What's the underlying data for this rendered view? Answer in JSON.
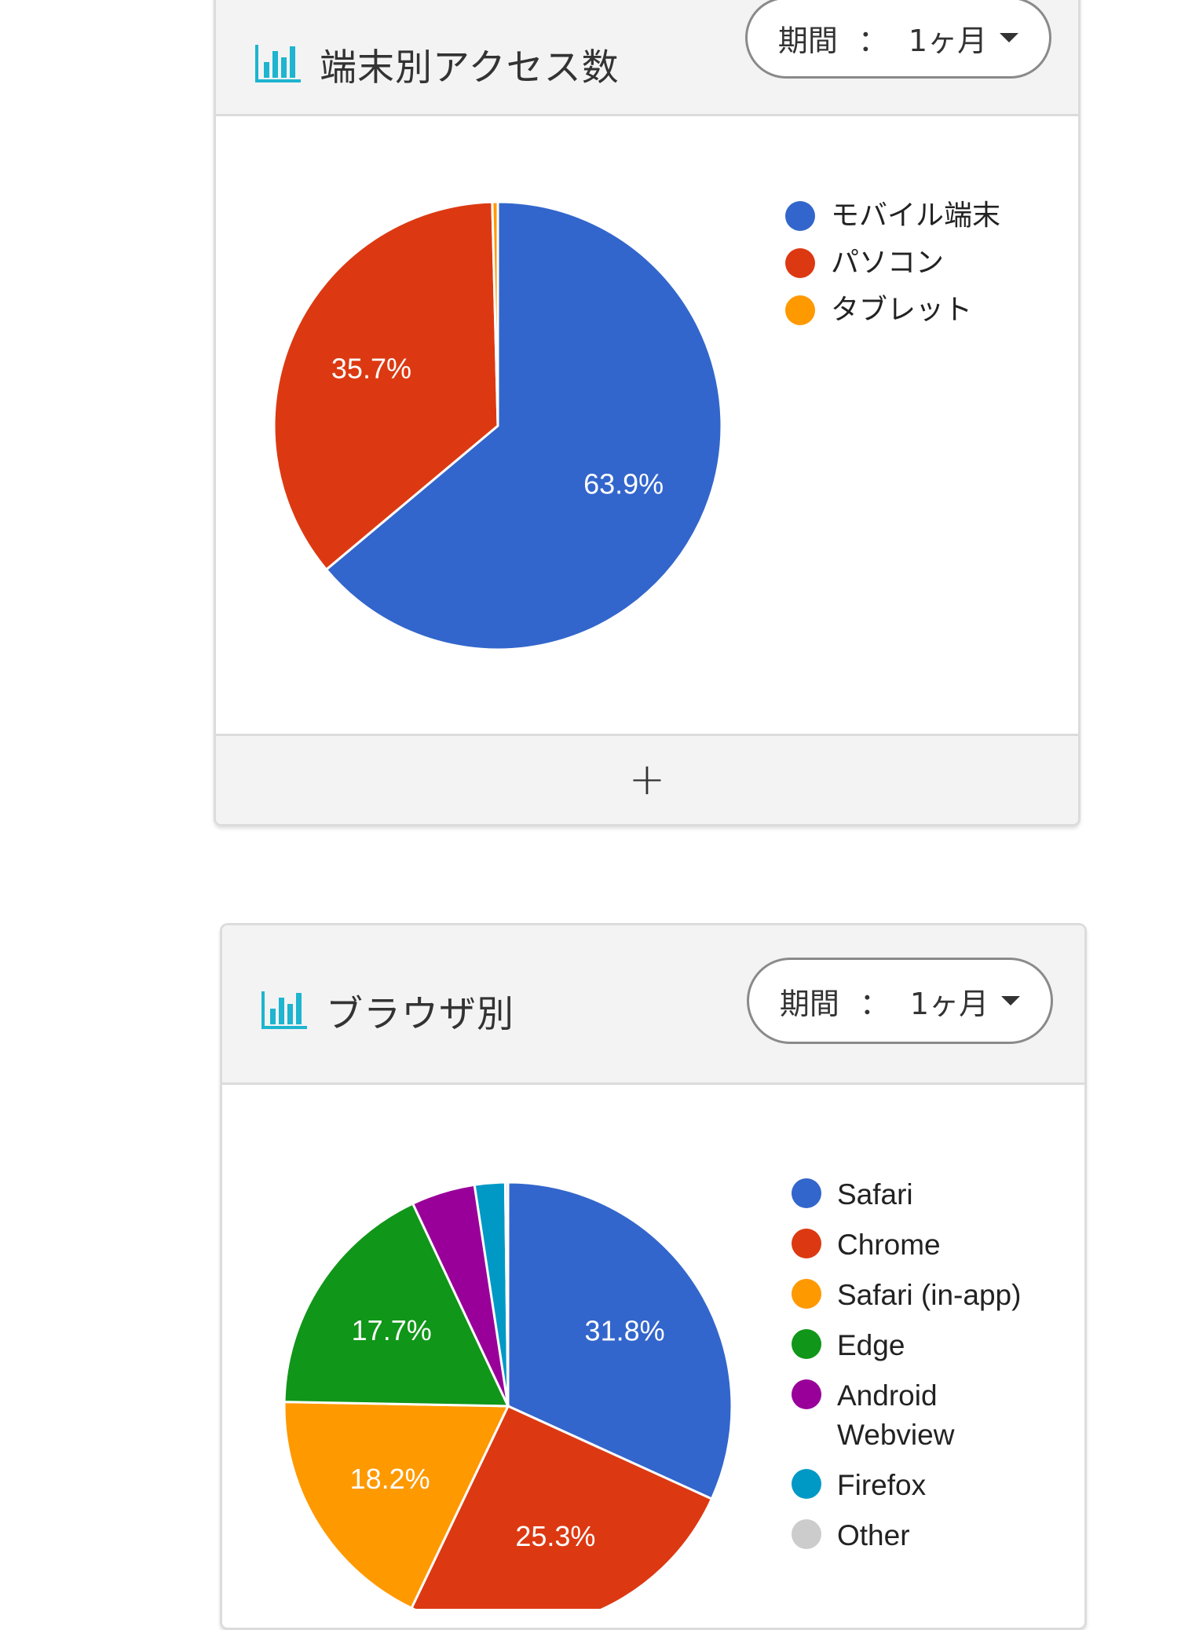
{
  "cards": [
    {
      "title": "端末別アクセス数",
      "icon": "bar-chart-icon",
      "period": {
        "label": "期間",
        "separator": "：",
        "value": "1ヶ月"
      },
      "footer_icon": "+"
    },
    {
      "title": "ブラウザ別",
      "icon": "bar-chart-icon",
      "period": {
        "label": "期間",
        "separator": "：",
        "value": "1ヶ月"
      }
    }
  ],
  "colors": {
    "accent_icon": "#1db5cf"
  },
  "chart_data": [
    {
      "type": "pie",
      "title": "端末別アクセス数",
      "legend": "right",
      "slices": [
        {
          "label": "モバイル端末",
          "value": 63.9,
          "display": "63.9%",
          "color": "#3366cc"
        },
        {
          "label": "パソコン",
          "value": 35.7,
          "display": "35.7%",
          "color": "#dc3912"
        },
        {
          "label": "タブレット",
          "value": 0.4,
          "display": "",
          "color": "#ff9900"
        }
      ]
    },
    {
      "type": "pie",
      "title": "ブラウザ別",
      "legend": "right",
      "slices": [
        {
          "label": "Safari",
          "value": 31.8,
          "display": "31.8%",
          "color": "#3366cc"
        },
        {
          "label": "Chrome",
          "value": 25.3,
          "display": "25.3%",
          "color": "#dc3912"
        },
        {
          "label": "Safari (in-app)",
          "value": 18.2,
          "display": "18.2%",
          "color": "#ff9900"
        },
        {
          "label": "Edge",
          "value": 17.7,
          "display": "17.7%",
          "color": "#109618"
        },
        {
          "label": "Android Webview",
          "value": 4.6,
          "display": "",
          "color": "#990099"
        },
        {
          "label": "Firefox",
          "value": 2.2,
          "display": "",
          "color": "#0099c6"
        },
        {
          "label": "Other",
          "value": 0.2,
          "display": "",
          "color": "#cccccc"
        }
      ]
    }
  ]
}
